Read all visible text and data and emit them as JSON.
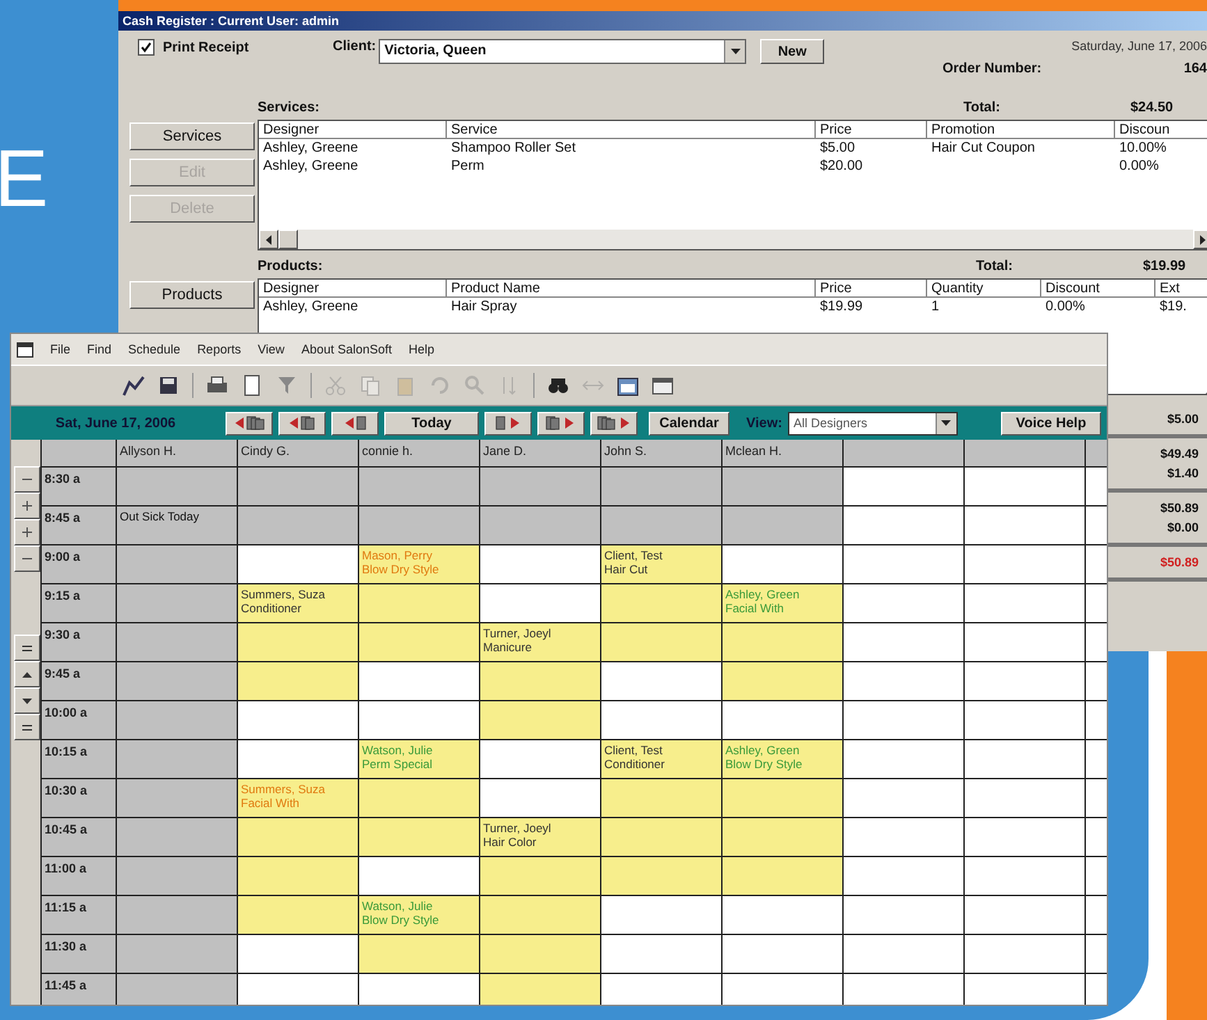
{
  "backdrop_letter": "E",
  "cash_register": {
    "title": "Cash Register : Current User: admin",
    "print_receipt": {
      "label": "Print Receipt",
      "checked": true
    },
    "client": {
      "label": "Client:",
      "value": "Victoria, Queen"
    },
    "new_button": "New",
    "date": "Saturday, June 17, 2006",
    "order_number_label": "Order Number:",
    "order_number": "164",
    "services": {
      "label": "Services:",
      "total_label": "Total:",
      "total": "$24.50",
      "buttons": [
        {
          "label": "Services",
          "disabled": false
        },
        {
          "label": "Edit",
          "disabled": true
        },
        {
          "label": "Delete",
          "disabled": true
        }
      ],
      "columns": [
        "Designer",
        "Service",
        "Price",
        "Promotion",
        "Discoun"
      ],
      "rows": [
        [
          "Ashley, Greene",
          "Shampoo Roller Set",
          "$5.00",
          "Hair Cut Coupon",
          "10.00%"
        ],
        [
          "Ashley, Greene",
          "Perm",
          "$20.00",
          "",
          "0.00%"
        ]
      ]
    },
    "products": {
      "label": "Products:",
      "total_label": "Total:",
      "total": "$19.99",
      "buttons": [
        {
          "label": "Products",
          "disabled": false
        }
      ],
      "columns": [
        "Designer",
        "Product Name",
        "Price",
        "Quantity",
        "Discount",
        "Ext"
      ],
      "rows": [
        [
          "Ashley, Greene",
          "Hair Spray",
          "$19.99",
          "1",
          "0.00%",
          "$19."
        ]
      ]
    },
    "summary_groups": [
      [
        {
          "text": "$5.00",
          "kind": "normal"
        }
      ],
      [
        {
          "text": "$49.49",
          "kind": "normal"
        },
        {
          "text": "$1.40",
          "kind": "normal"
        }
      ],
      [
        {
          "text": "$50.89",
          "kind": "normal"
        },
        {
          "text": "$0.00",
          "kind": "normal"
        }
      ],
      [
        {
          "text": "$50.89",
          "kind": "due"
        }
      ]
    ]
  },
  "scheduler": {
    "menu": [
      "File",
      "Find",
      "Schedule",
      "Reports",
      "View",
      "About SalonSoft",
      "Help"
    ],
    "date": "Sat, June 17, 2006",
    "nav": {
      "today": "Today",
      "calendar": "Calendar",
      "view_label": "View:",
      "view_value": "All Designers",
      "voice_help": "Voice Help"
    },
    "columns": [
      {
        "kind": "designer",
        "name": "Allyson H."
      },
      {
        "kind": "designer",
        "name": "Cindy G."
      },
      {
        "kind": "designer",
        "name": "connie h."
      },
      {
        "kind": "designer",
        "name": "Jane D."
      },
      {
        "kind": "designer",
        "name": "John S."
      },
      {
        "kind": "designer",
        "name": "Mclean H."
      },
      {
        "kind": "empty"
      },
      {
        "kind": "empty"
      },
      {
        "kind": "empty"
      }
    ],
    "rows": [
      {
        "time": "8:30 a",
        "cells": [
          {
            "kind": "off"
          },
          {
            "kind": "off"
          },
          {
            "kind": "off"
          },
          {
            "kind": "off"
          },
          {
            "kind": "off"
          },
          {
            "kind": "off"
          }
        ]
      },
      {
        "time": "8:45 a",
        "cells": [
          {
            "kind": "off",
            "note": "Out Sick Today"
          },
          {
            "kind": "off"
          },
          {
            "kind": "off"
          },
          {
            "kind": "off"
          },
          {
            "kind": "off"
          },
          {
            "kind": "off"
          }
        ]
      },
      {
        "time": "9:00 a",
        "cells": [
          {
            "kind": "off"
          },
          {
            "kind": "open"
          },
          {
            "kind": "booked",
            "client": "Mason, Perry",
            "service": "Blow Dry Style",
            "color": "#e07a10"
          },
          {
            "kind": "open"
          },
          {
            "kind": "booked",
            "client": "Client, Test",
            "service": "Hair Cut",
            "color": "#333333"
          },
          {
            "kind": "open"
          }
        ]
      },
      {
        "time": "9:15 a",
        "cells": [
          {
            "kind": "off"
          },
          {
            "kind": "booked",
            "client": "Summers, Suza",
            "service": "Conditioner",
            "color": "#333333"
          },
          {
            "kind": "booked"
          },
          {
            "kind": "open"
          },
          {
            "kind": "booked"
          },
          {
            "kind": "booked",
            "client": "Ashley, Green",
            "service": "Facial With",
            "color": "#3a9a3a"
          }
        ]
      },
      {
        "time": "9:30 a",
        "cells": [
          {
            "kind": "off"
          },
          {
            "kind": "booked"
          },
          {
            "kind": "booked"
          },
          {
            "kind": "booked",
            "client": "Turner, Joeyl",
            "service": "Manicure",
            "color": "#333333"
          },
          {
            "kind": "booked"
          },
          {
            "kind": "booked"
          }
        ]
      },
      {
        "time": "9:45 a",
        "cells": [
          {
            "kind": "off"
          },
          {
            "kind": "booked"
          },
          {
            "kind": "open"
          },
          {
            "kind": "booked"
          },
          {
            "kind": "open"
          },
          {
            "kind": "booked"
          }
        ]
      },
      {
        "time": "10:00 a",
        "cells": [
          {
            "kind": "off"
          },
          {
            "kind": "open"
          },
          {
            "kind": "open"
          },
          {
            "kind": "booked"
          },
          {
            "kind": "open"
          },
          {
            "kind": "open"
          }
        ]
      },
      {
        "time": "10:15 a",
        "cells": [
          {
            "kind": "off"
          },
          {
            "kind": "open"
          },
          {
            "kind": "booked",
            "client": "Watson, Julie",
            "service": "Perm Special",
            "color": "#3a9a3a"
          },
          {
            "kind": "open"
          },
          {
            "kind": "booked",
            "client": "Client, Test",
            "service": "Conditioner",
            "color": "#333333"
          },
          {
            "kind": "booked",
            "client": "Ashley, Green",
            "service": "Blow Dry Style",
            "color": "#3a9a3a"
          }
        ]
      },
      {
        "time": "10:30 a",
        "cells": [
          {
            "kind": "off"
          },
          {
            "kind": "booked",
            "client": "Summers, Suza",
            "service": "Facial With",
            "color": "#e07a10"
          },
          {
            "kind": "booked"
          },
          {
            "kind": "open"
          },
          {
            "kind": "booked"
          },
          {
            "kind": "booked"
          }
        ]
      },
      {
        "time": "10:45 a",
        "cells": [
          {
            "kind": "off"
          },
          {
            "kind": "booked"
          },
          {
            "kind": "booked"
          },
          {
            "kind": "booked",
            "client": "Turner, Joeyl",
            "service": "Hair Color",
            "color": "#333333"
          },
          {
            "kind": "booked"
          },
          {
            "kind": "booked"
          }
        ]
      },
      {
        "time": "11:00 a",
        "cells": [
          {
            "kind": "off"
          },
          {
            "kind": "booked"
          },
          {
            "kind": "open"
          },
          {
            "kind": "booked"
          },
          {
            "kind": "booked"
          },
          {
            "kind": "booked"
          }
        ]
      },
      {
        "time": "11:15 a",
        "cells": [
          {
            "kind": "off"
          },
          {
            "kind": "booked"
          },
          {
            "kind": "booked",
            "client": "Watson, Julie",
            "service": "Blow Dry Style",
            "color": "#3a9a3a"
          },
          {
            "kind": "booked"
          },
          {
            "kind": "open"
          },
          {
            "kind": "open"
          }
        ]
      },
      {
        "time": "11:30 a",
        "cells": [
          {
            "kind": "off"
          },
          {
            "kind": "open"
          },
          {
            "kind": "booked"
          },
          {
            "kind": "booked"
          },
          {
            "kind": "open"
          },
          {
            "kind": "open"
          }
        ]
      },
      {
        "time": "11:45 a",
        "cells": [
          {
            "kind": "off"
          },
          {
            "kind": "open"
          },
          {
            "kind": "open"
          },
          {
            "kind": "booked"
          },
          {
            "kind": "open"
          },
          {
            "kind": "open"
          }
        ]
      }
    ]
  }
}
